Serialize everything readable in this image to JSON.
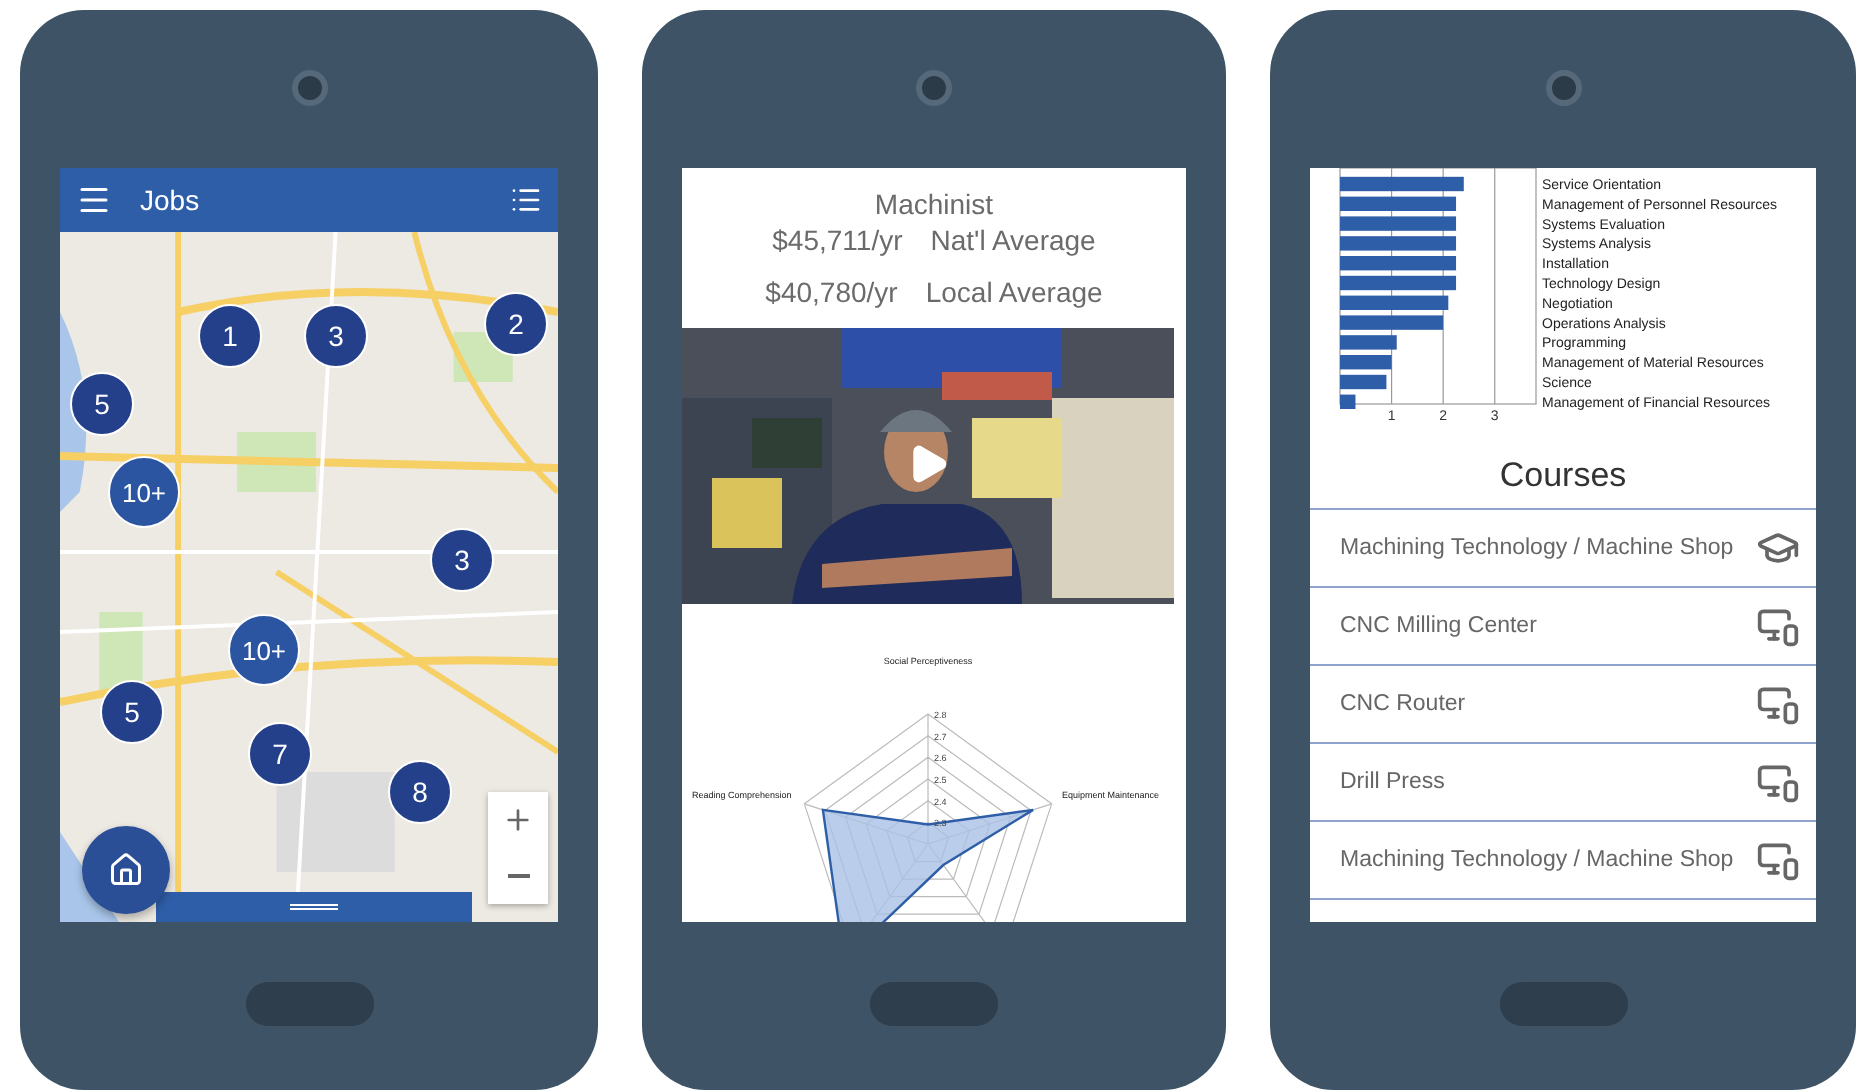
{
  "jobs_screen": {
    "title": "Jobs",
    "markers": [
      {
        "label": "1"
      },
      {
        "label": "3"
      },
      {
        "label": "2"
      },
      {
        "label": "5"
      },
      {
        "label": "10+"
      },
      {
        "label": "3"
      },
      {
        "label": "10+"
      },
      {
        "label": "5"
      },
      {
        "label": "7"
      },
      {
        "label": "8"
      }
    ]
  },
  "job_detail": {
    "title": "Machinist",
    "salaries": [
      {
        "amount": "$45,711/yr",
        "label": "Nat'l Average"
      },
      {
        "amount": "$40,780/yr",
        "label": "Local Average"
      }
    ],
    "radar": {
      "axes": [
        "Social Perceptiveness",
        "Reading Comprehension",
        "Equipment Maintenance"
      ],
      "ticks": [
        "2.8",
        "2.7",
        "2.6",
        "2.5",
        "2.4",
        "2.3"
      ]
    }
  },
  "skills": {
    "chart_data": {
      "type": "bar",
      "orientation": "horizontal",
      "categories": [
        "Service Orientation",
        "Management of Personnel Resources",
        "Systems Evaluation",
        "Systems Analysis",
        "Installation",
        "Technology Design",
        "Negotiation",
        "Operations Analysis",
        "Programming",
        "Management of Material Resources",
        "Science",
        "Management of Financial Resources"
      ],
      "series": [
        {
          "color": "#2f5ea8",
          "values": [
            2.4,
            2.25,
            2.25,
            2.25,
            2.25,
            2.25,
            2.1,
            2.0,
            1.1,
            1.0,
            0.9,
            0.3
          ]
        }
      ],
      "xlim": [
        0,
        3.8
      ],
      "xticks": [
        1,
        2,
        3
      ],
      "grid": true
    }
  },
  "courses": {
    "title": "Courses",
    "items": [
      {
        "name": "Machining Technology / Machine Shop",
        "kind": "school"
      },
      {
        "name": "CNC Milling Center",
        "kind": "devices"
      },
      {
        "name": "CNC Router",
        "kind": "devices"
      },
      {
        "name": "Drill Press",
        "kind": "devices"
      },
      {
        "name": "Machining Technology / Machine Shop",
        "kind": "devices"
      }
    ]
  }
}
